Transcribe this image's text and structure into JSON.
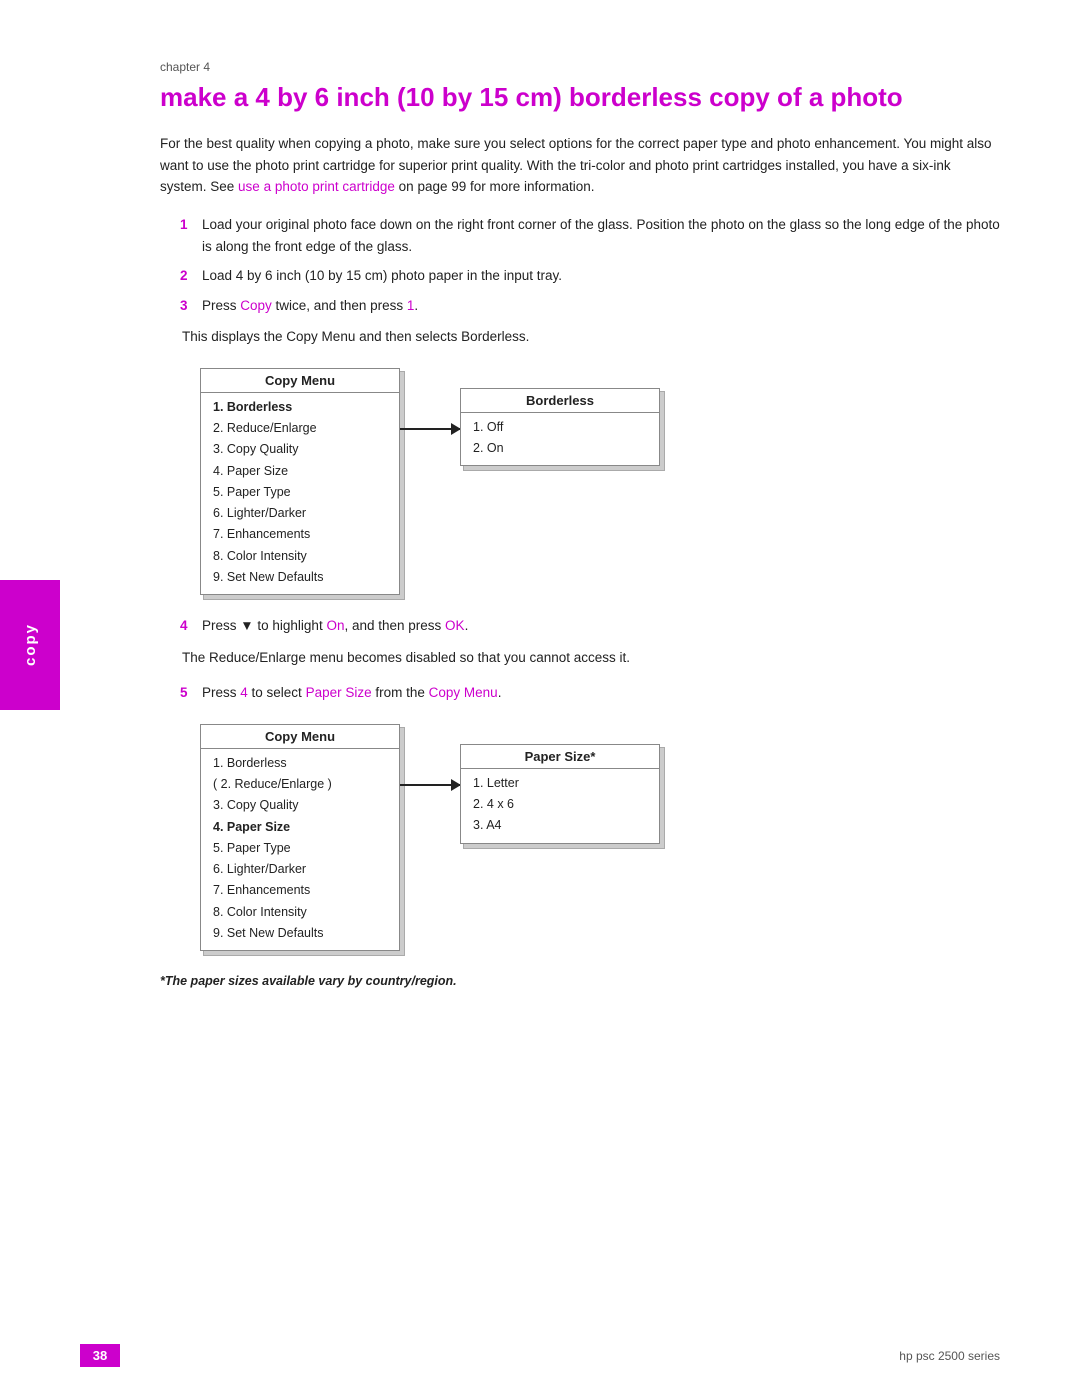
{
  "chapter": "chapter 4",
  "heading": "make a 4 by 6 inch (10 by 15 cm) borderless copy of a photo",
  "intro": "For the best quality when copying a photo, make sure you select options for the correct paper type and photo enhancement. You might also want to use the photo print cartridge for superior print quality. With the tri-color and photo print cartridges installed, you have a six-ink system. See",
  "intro_link": "use a photo print cartridge",
  "intro_suffix": " on page 99 for more information.",
  "steps": [
    {
      "number": "1",
      "text": "Load your original photo face down on the right front corner of the glass. Position the photo on the glass so the long edge of the photo is along the front edge of the glass."
    },
    {
      "number": "2",
      "text": "Load 4 by 6 inch (10 by 15 cm) photo paper in the input tray."
    },
    {
      "number": "3",
      "text_prefix": "Press ",
      "text_link": "Copy",
      "text_middle": " twice, and then press ",
      "text_link2": "1",
      "text_suffix": ".",
      "sub": "This displays the Copy Menu and then selects Borderless."
    }
  ],
  "menu1": {
    "header": "Copy Menu",
    "items": [
      {
        "text": "1. Borderless",
        "bold": true
      },
      {
        "text": "2. Reduce/Enlarge",
        "bold": false
      },
      {
        "text": "3. Copy Quality",
        "bold": false
      },
      {
        "text": "4. Paper Size",
        "bold": false
      },
      {
        "text": "5. Paper Type",
        "bold": false
      },
      {
        "text": "6. Lighter/Darker",
        "bold": false
      },
      {
        "text": "7. Enhancements",
        "bold": false
      },
      {
        "text": "8. Color Intensity",
        "bold": false
      },
      {
        "text": "9. Set New Defaults",
        "bold": false
      }
    ]
  },
  "menu1_right": {
    "header": "Borderless",
    "items": [
      {
        "text": "1. Off",
        "bold": false
      },
      {
        "text": "2. On",
        "bold": false
      }
    ]
  },
  "step4": {
    "number": "4",
    "text_prefix": "Press ",
    "text_link": "▼",
    "text_middle": " to highlight ",
    "text_link2": "On",
    "text_middle2": ", and then press ",
    "text_link3": "OK",
    "text_suffix": ".",
    "sub": "The Reduce/Enlarge menu becomes disabled so that you cannot access it."
  },
  "step5": {
    "number": "5",
    "text_prefix": "Press ",
    "text_link": "4",
    "text_middle": " to select ",
    "text_link2": "Paper Size",
    "text_middle2": " from the ",
    "text_link3": "Copy Menu",
    "text_suffix": "."
  },
  "menu2": {
    "header": "Copy Menu",
    "items": [
      {
        "text": "1. Borderless",
        "bold": false
      },
      {
        "text": "( 2. Reduce/Enlarge )",
        "bold": false
      },
      {
        "text": "3. Copy Quality",
        "bold": false
      },
      {
        "text": "4. Paper Size",
        "bold": true
      },
      {
        "text": "5. Paper Type",
        "bold": false
      },
      {
        "text": "6. Lighter/Darker",
        "bold": false
      },
      {
        "text": "7. Enhancements",
        "bold": false
      },
      {
        "text": "8. Color Intensity",
        "bold": false
      },
      {
        "text": "9. Set New Defaults",
        "bold": false
      }
    ]
  },
  "menu2_right": {
    "header": "Paper Size*",
    "items": [
      {
        "text": "1. Letter",
        "bold": false
      },
      {
        "text": "2. 4 x 6",
        "bold": false
      },
      {
        "text": "3. A4",
        "bold": false
      }
    ]
  },
  "footnote": "*The paper sizes available vary by country/region.",
  "footer": {
    "page": "38",
    "product": "hp psc 2500 series"
  },
  "sidebar_label": "copy",
  "colors": {
    "accent": "#cc00cc",
    "link": "#cc00cc"
  }
}
